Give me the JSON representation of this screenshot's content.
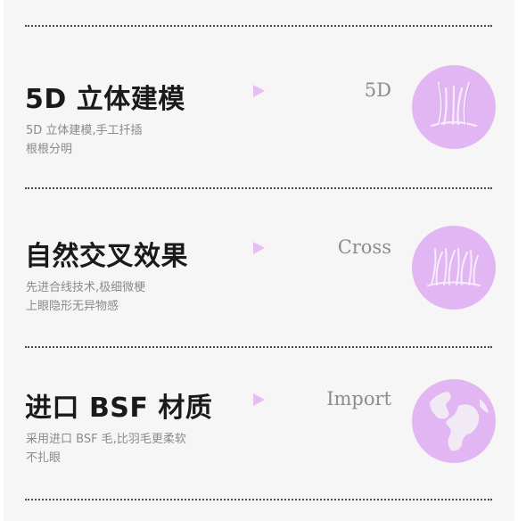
{
  "colors": {
    "panel": "#f6f6f6",
    "accent": "#e2b6f2",
    "title": "#1a1a1a",
    "desc": "#8a8a8a",
    "tag": "#8c8c8c"
  },
  "features": [
    {
      "title": "5D 立体建模",
      "desc_lines": [
        "5D 立体建模,手工扦插",
        "根根分明"
      ],
      "tag": "5D",
      "icon": "lash-crown-icon"
    },
    {
      "title": "自然交叉效果",
      "desc_lines": [
        "先进合线技术,极细微梗",
        "上眼隐形无异物感"
      ],
      "tag": "Cross",
      "icon": "cross-lash-icon"
    },
    {
      "title": "进口 BSF 材质",
      "desc_lines": [
        "采用进口 BSF 毛,比羽毛更柔软",
        "不扎眼"
      ],
      "tag": "Import",
      "icon": "globe-icon"
    }
  ]
}
